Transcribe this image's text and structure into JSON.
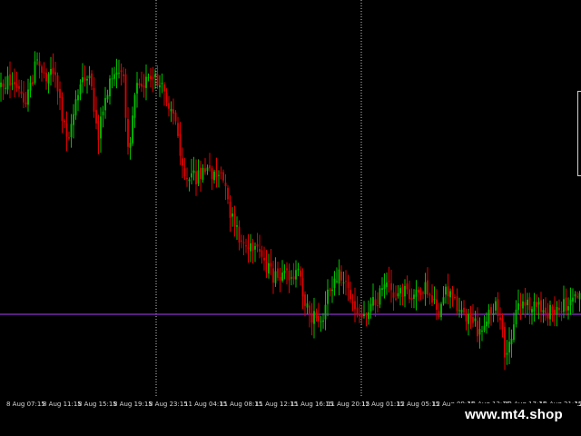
{
  "chart": {
    "background": "#000000",
    "bull_color": "#00c000",
    "bear_color": "#e00000",
    "separator_color": "#c8c8c8",
    "level_line_color": "#b03cff"
  },
  "time_axis": {
    "labels": [
      "8 Aug 07:15",
      "8 Aug 11:15",
      "8 Aug 15:15",
      "8 Aug 19:15",
      "8 Aug 23:15",
      "11 Aug 04:15",
      "11 Aug 08:15",
      "11 Aug 12:15",
      "11 Aug 16:15",
      "11 Aug 20:15",
      "12 Aug 01:15",
      "12 Aug 05:15",
      "12 Aug 09:15",
      "12 Aug 13:15",
      "12 Aug 17:15",
      "12 Aug 21:15",
      "12"
    ]
  },
  "watermark": {
    "text": "www.mt4.shop"
  }
}
